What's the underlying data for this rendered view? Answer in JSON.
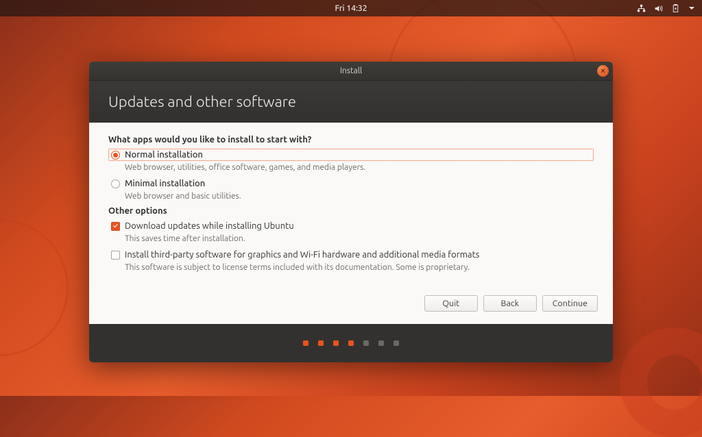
{
  "topbar": {
    "clock": "Fri 14:32"
  },
  "window": {
    "title": "Install",
    "heading": "Updates and other software"
  },
  "apps": {
    "question": "What apps would you like to install to start with?",
    "normal": {
      "label": "Normal installation",
      "desc": "Web browser, utilities, office software, games, and media players."
    },
    "minimal": {
      "label": "Minimal installation",
      "desc": "Web browser and basic utilities."
    }
  },
  "other": {
    "heading": "Other options",
    "download": {
      "label": "Download updates while installing Ubuntu",
      "desc": "This saves time after installation."
    },
    "thirdparty": {
      "label": "Install third-party software for graphics and Wi-Fi hardware and additional media formats",
      "desc": "This software is subject to license terms included with its documentation. Some is proprietary."
    }
  },
  "buttons": {
    "quit": "Quit",
    "back": "Back",
    "continue": "Continue"
  },
  "progress": {
    "total": 7,
    "current": 4
  }
}
